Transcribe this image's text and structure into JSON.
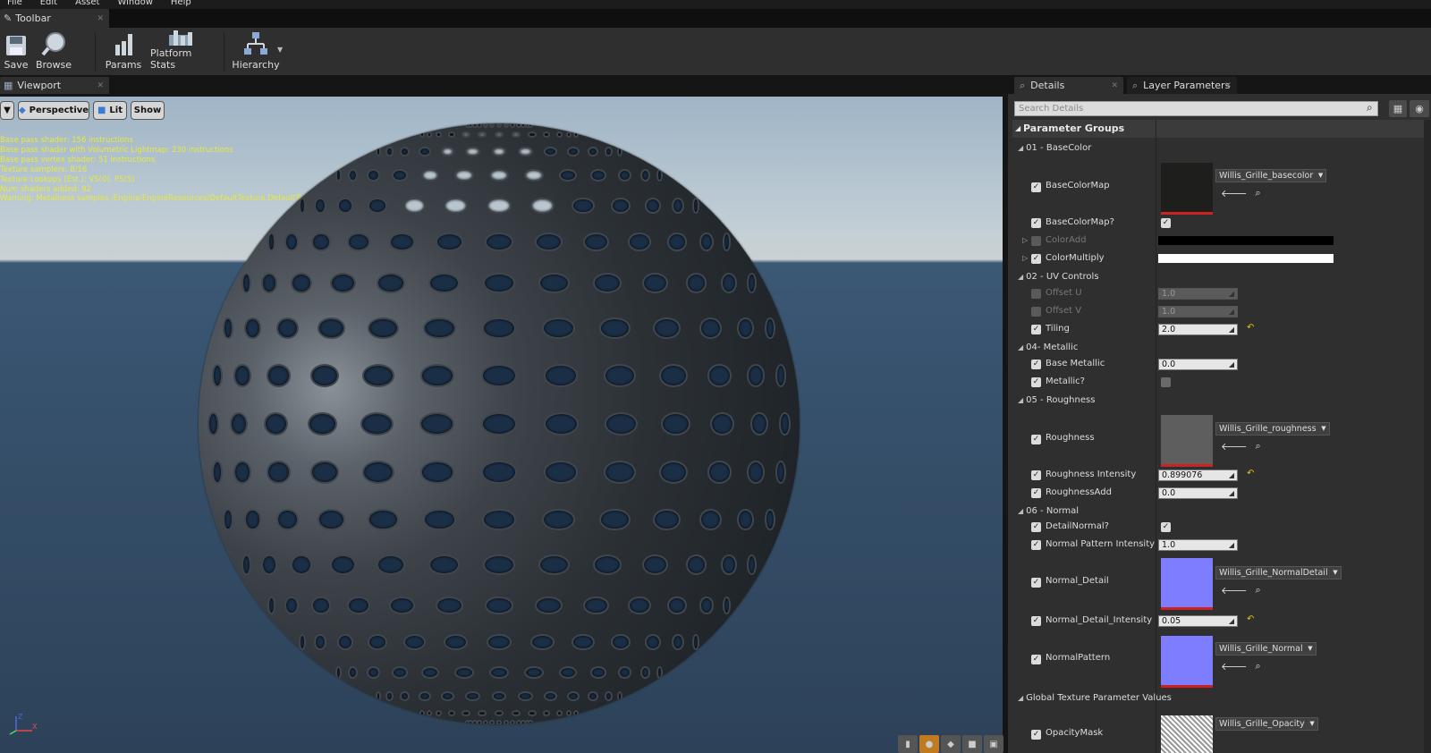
{
  "menu": [
    "File",
    "Edit",
    "Asset",
    "Window",
    "Help"
  ],
  "toolbar": {
    "tab_label": "Toolbar",
    "buttons": [
      {
        "label": "Save",
        "icon": "save-icon"
      },
      {
        "label": "Browse",
        "icon": "browse-icon"
      },
      {
        "label": "Params",
        "icon": "params-icon"
      },
      {
        "label": "Platform Stats",
        "icon": "platform-stats-icon"
      },
      {
        "label": "Hierarchy",
        "icon": "hierarchy-icon"
      }
    ]
  },
  "viewport": {
    "tab_label": "Viewport",
    "perspective": "Perspective",
    "lit": "Lit",
    "show": "Show",
    "stats": [
      "Base pass shader: 156 instructions",
      "Base pass shader with Volumetric Lightmap: 230 instructions",
      "Base pass vertex shader: 51 instructions",
      "Texture samplers: 8/16",
      "Texture Lookups (Est.): VS(0), PS(5)",
      "Num shaders added: 92",
      "Warning: Metalness samples /Engine/EngineResources/DefaultTexture.DefaultTexture as Linear Color"
    ]
  },
  "details": {
    "tab_details": "Details",
    "tab_layers": "Layer Parameters",
    "search_placeholder": "Search Details",
    "header": "Parameter Groups",
    "groups": {
      "g1": "01 - BaseColor",
      "g2": "02 - UV Controls",
      "g4": "04- Metallic",
      "g5": "05 - Roughness",
      "g6": "06 - Normal",
      "gt": "Global Texture Parameter Values"
    },
    "params": {
      "basecolormap": "BaseColorMap",
      "basecolormap_asset": "Willis_Grille_basecolor",
      "basecolormap_q": "BaseColorMap?",
      "coloradd": "ColorAdd",
      "colormultiply": "ColorMultiply",
      "offsetu": "Offset U",
      "offsetu_v": "1.0",
      "offsetv": "Offset V",
      "offsetv_v": "1.0",
      "tiling": "Tiling",
      "tiling_v": "2.0",
      "basemetallic": "Base Metallic",
      "basemetallic_v": "0.0",
      "metallic_q": "Metallic?",
      "roughness": "Roughness",
      "roughness_asset": "Willis_Grille_roughness",
      "roughint": "Roughness Intensity",
      "roughint_v": "0.899076",
      "roughadd": "RoughnessAdd",
      "roughadd_v": "0.0",
      "detailnormal_q": "DetailNormal?",
      "npi": "Normal Pattern Intensity",
      "npi_v": "1.0",
      "normaldetail": "Normal_Detail",
      "normaldetail_asset": "Willis_Grille_NormalDetail",
      "ndi": "Normal_Detail_Intensity",
      "ndi_v": "0.05",
      "normalpattern": "NormalPattern",
      "normalpattern_asset": "Willis_Grille_Normal",
      "opacitymask": "OpacityMask",
      "opacitymask_asset": "Willis_Grille_Opacity"
    }
  },
  "colors": {
    "basecolor_thumb": "#1e1f1d",
    "roughness_thumb": "#5e5e5e",
    "normal_thumb": "#7f7dff",
    "coloradd": "#000000",
    "colormultiply": "#ffffff",
    "stats_text": "#e8e840"
  }
}
